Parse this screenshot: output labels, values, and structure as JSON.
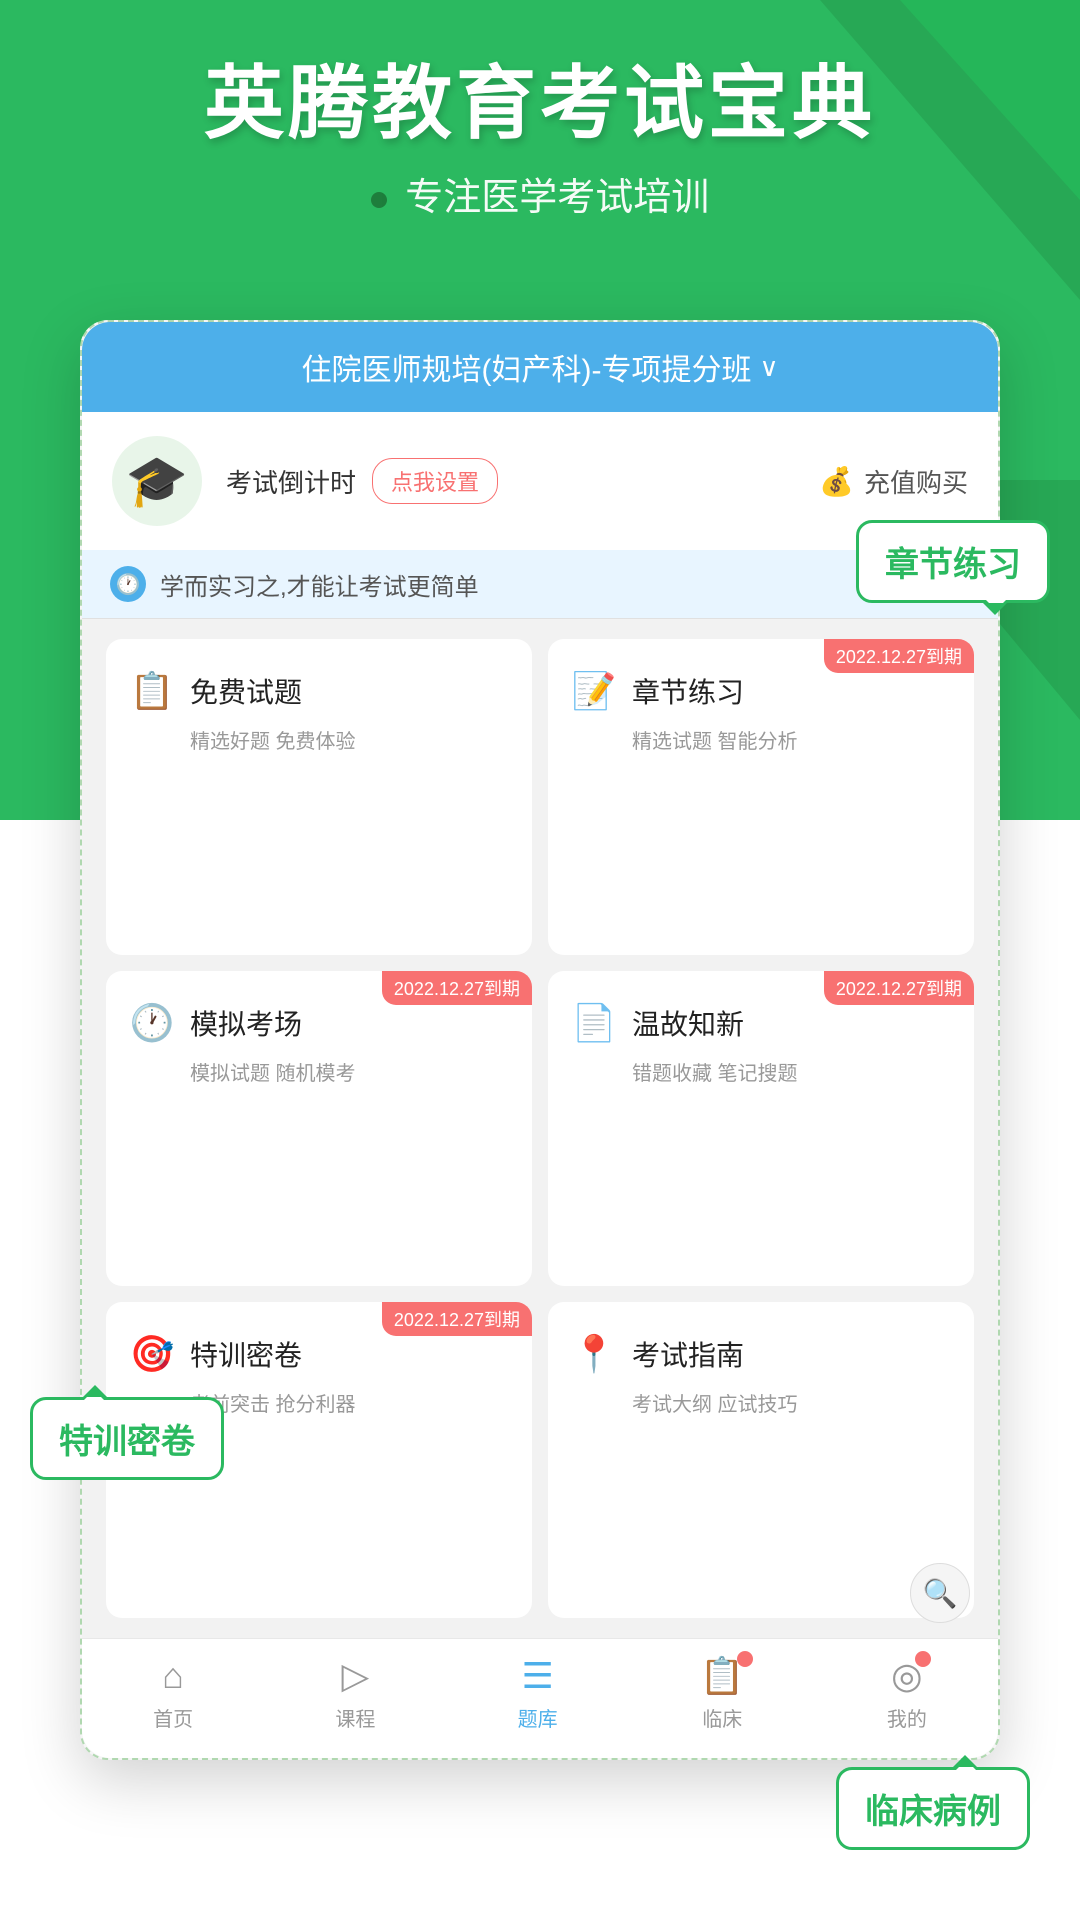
{
  "header": {
    "title": "英腾教育考试宝典",
    "subtitle": "专注医学考试培训"
  },
  "app": {
    "course_selector": {
      "text": "住院医师规培(妇产科)-专项提分班",
      "arrow": "∨"
    },
    "user": {
      "avatar_emoji": "🎓",
      "countdown_label": "考试倒计时",
      "set_button": "点我设置",
      "recharge_label": "充值购买"
    },
    "notice": {
      "text": "学而实习之,才能让考试更简单"
    },
    "features": [
      {
        "id": "free-questions",
        "icon": "📋",
        "icon_color": "#4dafea",
        "title": "免费试题",
        "desc": "精选好题 免费体验",
        "badge": null
      },
      {
        "id": "chapter-practice",
        "icon": "📝",
        "icon_color": "#4dafea",
        "title": "章节练习",
        "desc": "精选试题 智能分析",
        "badge": "2022.12.27到期"
      },
      {
        "id": "mock-exam",
        "icon": "🕐",
        "icon_color": "#f5a623",
        "title": "模拟考场",
        "desc": "模拟试题 随机模考",
        "badge": "2022.12.27到期"
      },
      {
        "id": "review",
        "icon": "📄",
        "icon_color": "#4dafea",
        "title": "温故知新",
        "desc": "错题收藏 笔记搜题",
        "badge": "2022.12.27到期"
      },
      {
        "id": "special-exam",
        "icon": "🎯",
        "icon_color": "#f87171",
        "title": "特训密卷",
        "desc": "考前突击 抢分利器",
        "badge": "2022.12.27到期"
      },
      {
        "id": "exam-guide",
        "icon": "📍",
        "icon_color": "#f87171",
        "title": "考试指南",
        "desc": "考试大纲 应试技巧",
        "badge": null
      }
    ],
    "nav": [
      {
        "id": "home",
        "icon": "⌂",
        "label": "首页",
        "active": false
      },
      {
        "id": "course",
        "icon": "▶",
        "label": "课程",
        "active": false
      },
      {
        "id": "questions",
        "icon": "≡",
        "label": "题库",
        "active": true
      },
      {
        "id": "clinical",
        "icon": "📋",
        "label": "临床",
        "active": false,
        "badge": true
      },
      {
        "id": "mine",
        "icon": "○",
        "label": "我的",
        "active": false,
        "badge": true
      }
    ]
  },
  "callouts": {
    "chapter": "章节练习",
    "miji": "特训密卷",
    "clinical": "临床病例"
  },
  "colors": {
    "primary_green": "#2bb960",
    "primary_blue": "#4dafea",
    "accent_red": "#f87171",
    "accent_orange": "#f5a623"
  }
}
